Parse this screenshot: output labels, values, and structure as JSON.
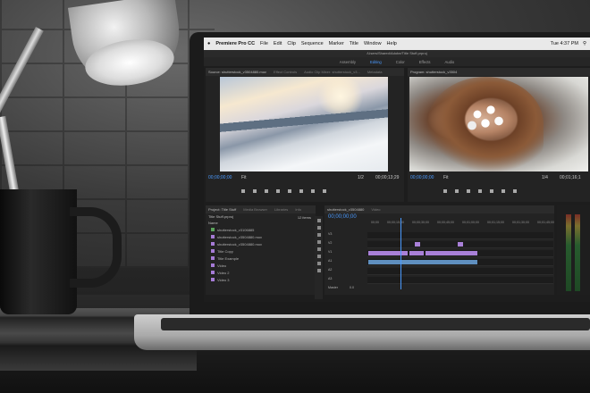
{
  "menubar": {
    "app_name": "Premiere Pro CC",
    "items": [
      "File",
      "Edit",
      "Clip",
      "Sequence",
      "Marker",
      "Title",
      "Window",
      "Help"
    ],
    "clock": "Tue 4:37 PM"
  },
  "title_path": "/Users/Shared/Adobe/Title Stuff.prproj",
  "workspaces": [
    {
      "label": "Assembly",
      "active": false
    },
    {
      "label": "Editing",
      "active": true
    },
    {
      "label": "Color",
      "active": false
    },
    {
      "label": "Effects",
      "active": false
    },
    {
      "label": "Audio",
      "active": false
    }
  ],
  "source_panel": {
    "tabs": [
      "Source: shutterstock_v3504880.mov",
      "Effect Controls",
      "Audio Clip Mixer: shutterstock_v3...",
      "Metadata"
    ],
    "timecode": "00;00;00;00",
    "fit": "Fit",
    "ratio": "1/2",
    "duration": "00;00;13;29"
  },
  "program_panel": {
    "tabs": [
      "Program: shutterstock_v3504"
    ],
    "timecode": "00;00;00;00",
    "fit": "Fit",
    "ratio": "1/4",
    "duration": "00;01;16;1"
  },
  "project_panel": {
    "tabs": [
      "Project: Title Stuff",
      "Media Browser",
      "Libraries",
      "Info"
    ],
    "file": "Title Stuff.prproj",
    "count": "12 items",
    "header": "Name",
    "items": [
      {
        "name": "shutterstock_v3106885",
        "color": "green"
      },
      {
        "name": "shutterstock_v3504880.mov",
        "color": "purple"
      },
      {
        "name": "shutterstock_v3504880.mov",
        "color": "purple"
      },
      {
        "name": "Title Copy",
        "color": "purple"
      },
      {
        "name": "Title Example",
        "color": "purple"
      },
      {
        "name": "Video",
        "color": "purple"
      },
      {
        "name": "Video 2",
        "color": "purple"
      },
      {
        "name": "Video 3",
        "color": "purple"
      }
    ]
  },
  "timeline_panel": {
    "tabs": [
      "shutterstock_v3504880",
      "Video"
    ],
    "timecode": "00;00;00;00",
    "ruler": [
      "00;00",
      "00;00;15;00",
      "00;00;30;00",
      "00;00;45;00",
      "00;01;00;00",
      "00;01;15;00",
      "00;01;30;00",
      "00;01;45;00"
    ],
    "tracks": [
      "V3",
      "V2",
      "V1",
      "A1",
      "A2",
      "A3",
      "Master"
    ],
    "clips": [
      "shutterstock_v3504",
      "shutt",
      "shutterstock_v3504880"
    ],
    "master_value": "0.0"
  }
}
